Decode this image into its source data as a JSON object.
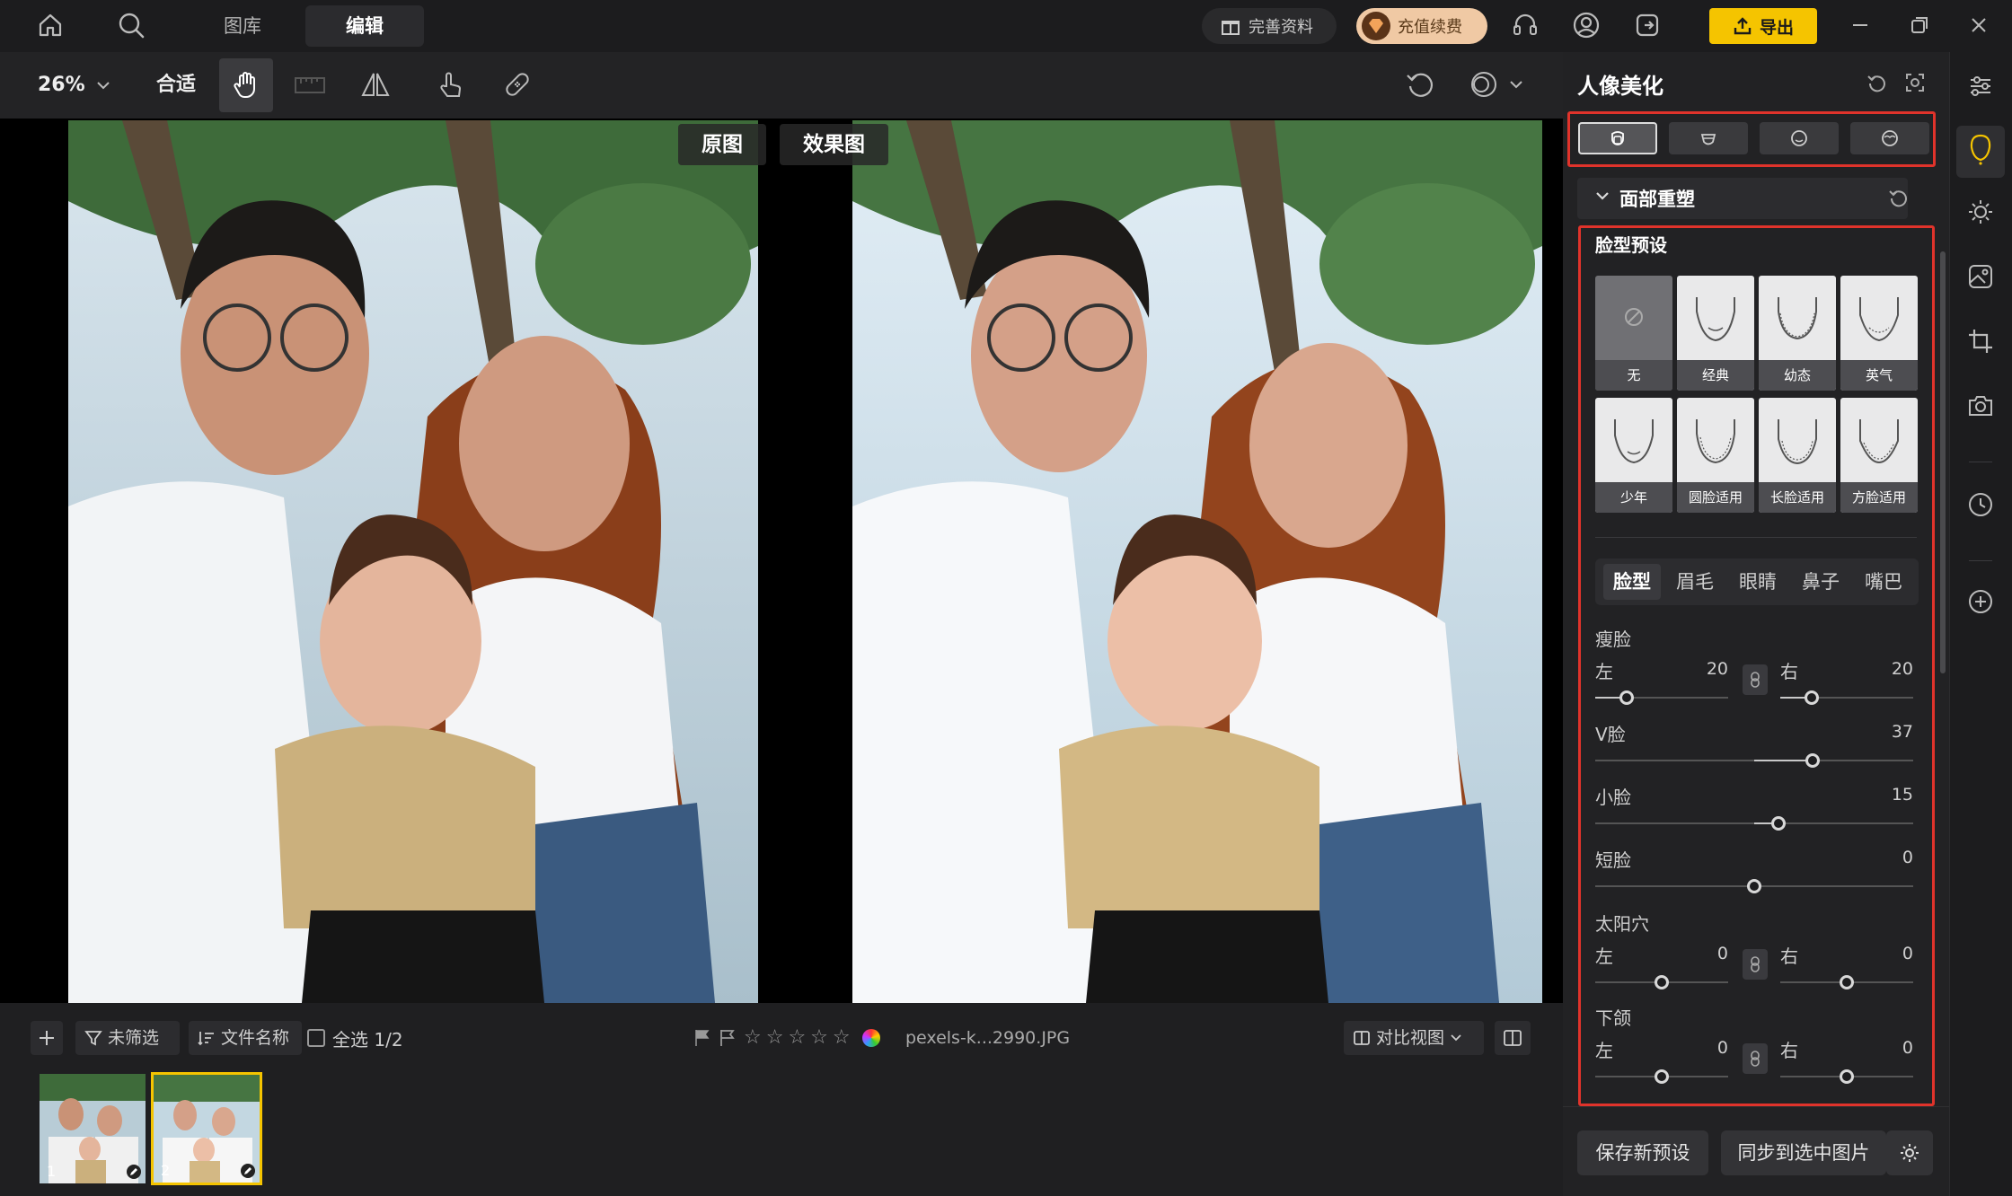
{
  "topbar": {
    "tabs": [
      {
        "label": "图库"
      },
      {
        "label": "编辑"
      }
    ],
    "complete_profile": "完善资料",
    "recharge": "充值续费",
    "export": "导出"
  },
  "toolbar": {
    "zoom": "26%",
    "fit": "合适"
  },
  "canvas": {
    "original_label": "原图",
    "result_label": "效果图"
  },
  "filmstrip": {
    "filter": "未筛选",
    "sort": "文件名称",
    "select_all": "全选 1/2",
    "filename": "pexels-k...2990.JPG",
    "compare_view": "对比视图",
    "thumbs": [
      {
        "index": "1"
      },
      {
        "index": "2"
      }
    ]
  },
  "panel": {
    "title": "人像美化",
    "section": "面部重塑",
    "preset_title": "脸型预设",
    "presets": [
      {
        "label": "无"
      },
      {
        "label": "经典"
      },
      {
        "label": "幼态"
      },
      {
        "label": "英气"
      },
      {
        "label": "少年"
      },
      {
        "label": "圆脸适用"
      },
      {
        "label": "长脸适用"
      },
      {
        "label": "方脸适用"
      }
    ],
    "subtabs": [
      {
        "label": "脸型"
      },
      {
        "label": "眉毛"
      },
      {
        "label": "眼睛"
      },
      {
        "label": "鼻子"
      },
      {
        "label": "嘴巴"
      }
    ],
    "sliders": {
      "slim_face": {
        "label": "瘦脸",
        "left_label": "左",
        "left_value": "20",
        "right_label": "右",
        "right_value": "20"
      },
      "v_face": {
        "label": "V脸",
        "value": "37"
      },
      "small_face": {
        "label": "小脸",
        "value": "15"
      },
      "short_face": {
        "label": "短脸",
        "value": "0"
      },
      "temple": {
        "label": "太阳穴",
        "left_label": "左",
        "left_value": "0",
        "right_label": "右",
        "right_value": "0"
      },
      "jaw": {
        "label": "下颌",
        "left_label": "左",
        "left_value": "0",
        "right_label": "右",
        "right_value": "0"
      }
    },
    "save_preset": "保存新预设",
    "sync": "同步到选中图片"
  },
  "colors": {
    "accent": "#f5c400",
    "highlight_border": "#e0332b",
    "recharge_bg": "#f0c9a4"
  }
}
